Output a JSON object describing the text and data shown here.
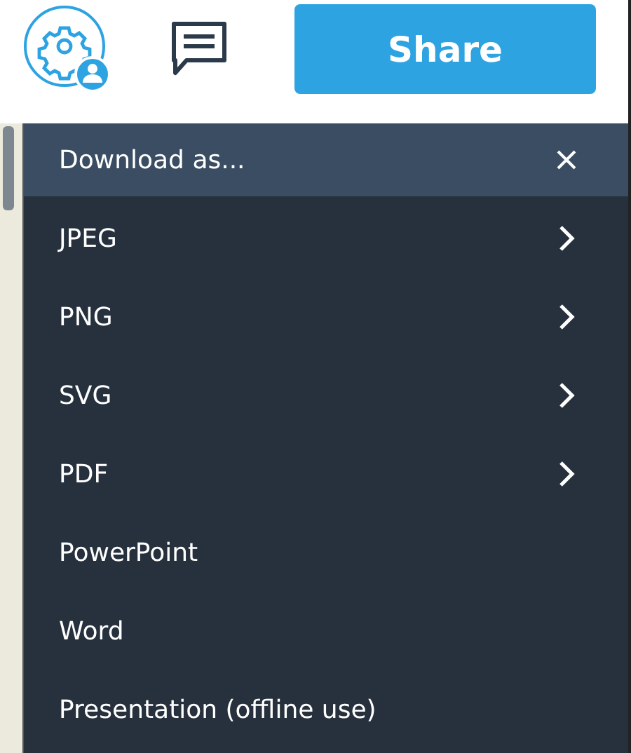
{
  "toolbar": {
    "share_button": "Share"
  },
  "download_menu": {
    "title": "Download as...",
    "items": [
      {
        "label": "JPEG",
        "has_submenu": true
      },
      {
        "label": "PNG",
        "has_submenu": true
      },
      {
        "label": "SVG",
        "has_submenu": true
      },
      {
        "label": "PDF",
        "has_submenu": true
      },
      {
        "label": "PowerPoint",
        "has_submenu": false
      },
      {
        "label": "Word",
        "has_submenu": false
      },
      {
        "label": "Presentation (offline use)",
        "has_submenu": false
      }
    ]
  }
}
